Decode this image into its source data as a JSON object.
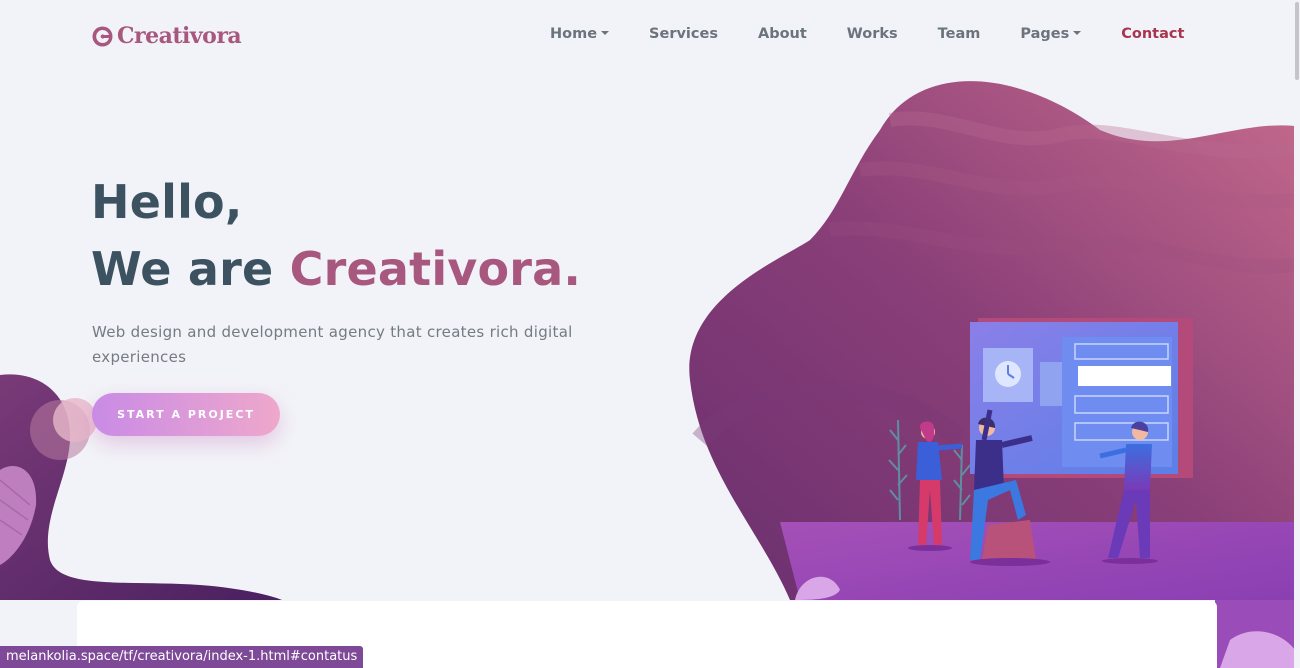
{
  "header": {
    "logo_text": "Creativora",
    "nav": [
      {
        "label": "Home",
        "dropdown": true
      },
      {
        "label": "Services",
        "dropdown": false
      },
      {
        "label": "About",
        "dropdown": false
      },
      {
        "label": "Works",
        "dropdown": false
      },
      {
        "label": "Team",
        "dropdown": false
      },
      {
        "label": "Pages",
        "dropdown": true
      },
      {
        "label": "Contact",
        "dropdown": false,
        "active": true
      }
    ]
  },
  "hero": {
    "line1": "Hello,",
    "line2_prefix": "We are ",
    "line2_brand": "Creativora.",
    "subtitle": "Web design and development agency that creates rich digital experiences",
    "cta_label": "START A PROJECT"
  },
  "status_bar": {
    "url": "melankolia.space/tf/creativora/index-1.html#contatus"
  },
  "colors": {
    "background": "#f2f3f8",
    "heading": "#3d5261",
    "brand": "#a8577f",
    "contact_link": "#a8354f",
    "cta_gradient_start": "#c98be6",
    "cta_gradient_end": "#eea8cb"
  }
}
